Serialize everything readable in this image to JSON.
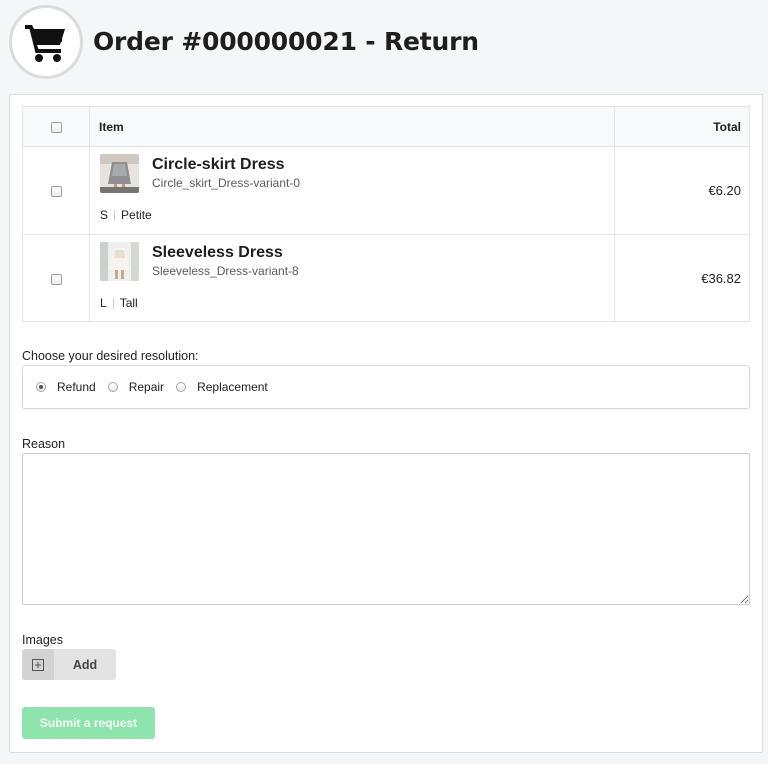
{
  "header": {
    "title": "Order #000000021 - Return",
    "icon": "shopping-cart-icon"
  },
  "table": {
    "headers": {
      "item": "Item",
      "total": "Total"
    },
    "rows": [
      {
        "name": "Circle-skirt Dress",
        "sku": "Circle_skirt_Dress-variant-0",
        "size": "S",
        "fit": "Petite",
        "total": "€6.20",
        "checked": false
      },
      {
        "name": "Sleeveless Dress",
        "sku": "Sleeveless_Dress-variant-8",
        "size": "L",
        "fit": "Tall",
        "total": "€36.82",
        "checked": false
      }
    ]
  },
  "resolution": {
    "label": "Choose your desired resolution:",
    "options": [
      "Refund",
      "Repair",
      "Replacement"
    ],
    "selected": "Refund"
  },
  "reason": {
    "label": "Reason",
    "value": ""
  },
  "images": {
    "label": "Images",
    "add_label": "Add",
    "add_icon": "plus-square-icon"
  },
  "submit": {
    "label": "Submit a request",
    "color": "#8fe3ad"
  }
}
